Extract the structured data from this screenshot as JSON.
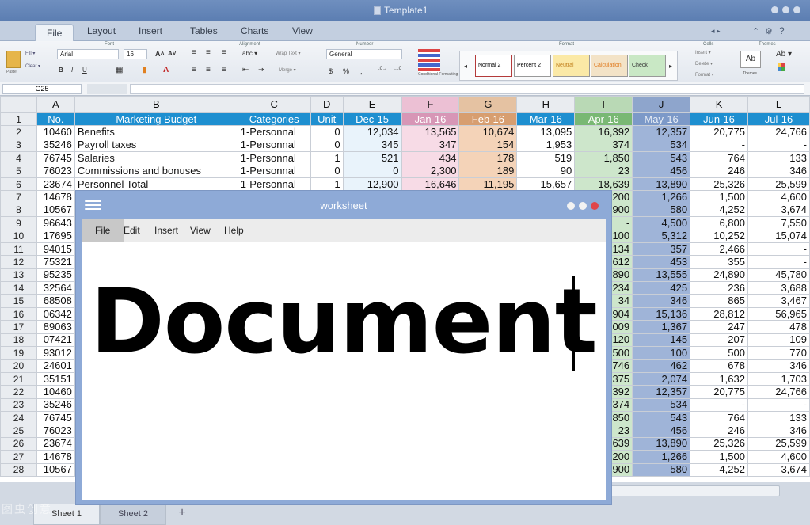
{
  "window": {
    "title": "Template1"
  },
  "ribbon_tabs": [
    "File",
    "Layout",
    "Insert",
    "Tables",
    "Charts",
    "View"
  ],
  "ribbon": {
    "groups": {
      "font": "Font",
      "alignment": "Alignment",
      "number": "Number",
      "format": "Format",
      "cells": "Cells",
      "themes": "Themes"
    },
    "paste": "Paste",
    "fill": "Fill ▾",
    "clear": "Clear ▾",
    "font_name": "Arial",
    "font_size": "16",
    "orientation": "abc ▾",
    "wrap_text": "Wrap Text ▾",
    "merge": "Merge ▾",
    "number_format": "General",
    "conditional_formatting": "Conditional Formatting",
    "styles": [
      "Normal 2",
      "Percent 2",
      "Neutral",
      "Calculation",
      "Check"
    ],
    "insert": "Insert ▾",
    "delete": "Delete ▾",
    "format": "Format ▾",
    "themes": "Themes",
    "themes_icon": "Ab",
    "themes_fonts": "Ab ▾"
  },
  "formula_bar": {
    "cell_ref": "G25"
  },
  "columns": [
    "A",
    "B",
    "C",
    "D",
    "E",
    "F",
    "G",
    "H",
    "I",
    "J",
    "K",
    "L"
  ],
  "header_row": [
    "No.",
    "Marketing Budget",
    "Categories",
    "Unit",
    "Dec-15",
    "Jan-16",
    "Feb-16",
    "Mar-16",
    "Apr-16",
    "May-16",
    "Jun-16",
    "Jul-16"
  ],
  "rows": [
    [
      "10460",
      "Benefits",
      "1-Personnal",
      "0",
      "12,034",
      "13,565",
      "10,674",
      "13,095",
      "16,392",
      "12,357",
      "20,775",
      "24,766"
    ],
    [
      "35246",
      "Payroll taxes",
      "1-Personnal",
      "0",
      "345",
      "347",
      "154",
      "1,953",
      "374",
      "534",
      "-",
      "-"
    ],
    [
      "76745",
      "Salaries",
      "1-Personnal",
      "1",
      "521",
      "434",
      "178",
      "519",
      "1,850",
      "543",
      "764",
      "133"
    ],
    [
      "76023",
      "Commissions and bonuses",
      "1-Personnal",
      "0",
      "0",
      "2,300",
      "189",
      "90",
      "23",
      "456",
      "246",
      "346"
    ],
    [
      "23674",
      "Personnel Total",
      "1-Personnal",
      "1",
      "12,900",
      "16,646",
      "11,195",
      "15,657",
      "18,639",
      "13,890",
      "25,326",
      "25,599"
    ],
    [
      "14678",
      "",
      "",
      "",
      "",
      "",
      "",
      "",
      "200",
      "1,266",
      "1,500",
      "4,600"
    ],
    [
      "10567",
      "",
      "",
      "",
      "",
      "",
      "",
      "",
      "900",
      "580",
      "4,252",
      "3,674"
    ],
    [
      "96643",
      "",
      "",
      "",
      "",
      "",
      "",
      "",
      "-",
      "4,500",
      "6,800",
      "7,550"
    ],
    [
      "17695",
      "",
      "",
      "",
      "",
      "",
      "",
      "",
      "100",
      "5,312",
      "10,252",
      "15,074"
    ],
    [
      "94015",
      "",
      "",
      "",
      "",
      "",
      "",
      "",
      "134",
      "357",
      "2,466",
      "-"
    ],
    [
      "75321",
      "",
      "",
      "",
      "",
      "",
      "",
      "",
      "612",
      "453",
      "355",
      "-"
    ],
    [
      "95235",
      "",
      "",
      "",
      "",
      "",
      "",
      "",
      "890",
      "13,555",
      "24,890",
      "45,780"
    ],
    [
      "32564",
      "",
      "",
      "",
      "",
      "",
      "",
      "",
      "234",
      "425",
      "236",
      "3,688"
    ],
    [
      "68508",
      "",
      "",
      "",
      "",
      "",
      "",
      "",
      "34",
      "346",
      "865",
      "3,467"
    ],
    [
      "06342",
      "",
      "",
      "",
      "",
      "",
      "",
      "",
      "904",
      "15,136",
      "28,812",
      "56,965"
    ],
    [
      "89063",
      "",
      "",
      "",
      "",
      "",
      "",
      "",
      "009",
      "1,367",
      "247",
      "478"
    ],
    [
      "07421",
      "",
      "",
      "",
      "",
      "",
      "",
      "",
      "120",
      "145",
      "207",
      "109"
    ],
    [
      "93012",
      "",
      "",
      "",
      "",
      "",
      "",
      "",
      "500",
      "100",
      "500",
      "770"
    ],
    [
      "24601",
      "",
      "",
      "",
      "",
      "",
      "",
      "",
      "746",
      "462",
      "678",
      "346"
    ],
    [
      "35151",
      "",
      "",
      "",
      "",
      "",
      "",
      "",
      "375",
      "2,074",
      "1,632",
      "1,703"
    ],
    [
      "10460",
      "",
      "",
      "",
      "",
      "",
      "",
      "",
      "392",
      "12,357",
      "20,775",
      "24,766"
    ],
    [
      "35246",
      "",
      "",
      "",
      "",
      "",
      "",
      "",
      "374",
      "534",
      "-",
      "-"
    ],
    [
      "76745",
      "",
      "",
      "",
      "",
      "",
      "",
      "",
      "850",
      "543",
      "764",
      "133"
    ],
    [
      "76023",
      "",
      "",
      "",
      "",
      "",
      "",
      "",
      "23",
      "456",
      "246",
      "346"
    ],
    [
      "23674",
      "",
      "",
      "",
      "",
      "",
      "",
      "",
      "639",
      "13,890",
      "25,326",
      "25,599"
    ],
    [
      "14678",
      "",
      "",
      "",
      "",
      "",
      "",
      "",
      "200",
      "1,266",
      "1,500",
      "4,600"
    ],
    [
      "10567",
      "",
      "",
      "",
      "",
      "",
      "",
      "",
      "900",
      "580",
      "4,252",
      "3,674"
    ]
  ],
  "sheets": [
    "Sheet 1",
    "Sheet 2"
  ],
  "sheets_add": "+",
  "worksheet": {
    "title": "worksheet",
    "menu": [
      "File",
      "Edit",
      "Insert",
      "View",
      "Help"
    ],
    "text": "Document"
  },
  "watermark": "图虫创意",
  "colors": {
    "header_blue": "#1e8fd0",
    "col_F": "#f7dbe6",
    "col_G": "#f4d3b8",
    "col_I": "#cde6cb",
    "col_J": "#9fb4d8",
    "window_blue": "#8eaad7",
    "close_red": "#e0454b"
  }
}
